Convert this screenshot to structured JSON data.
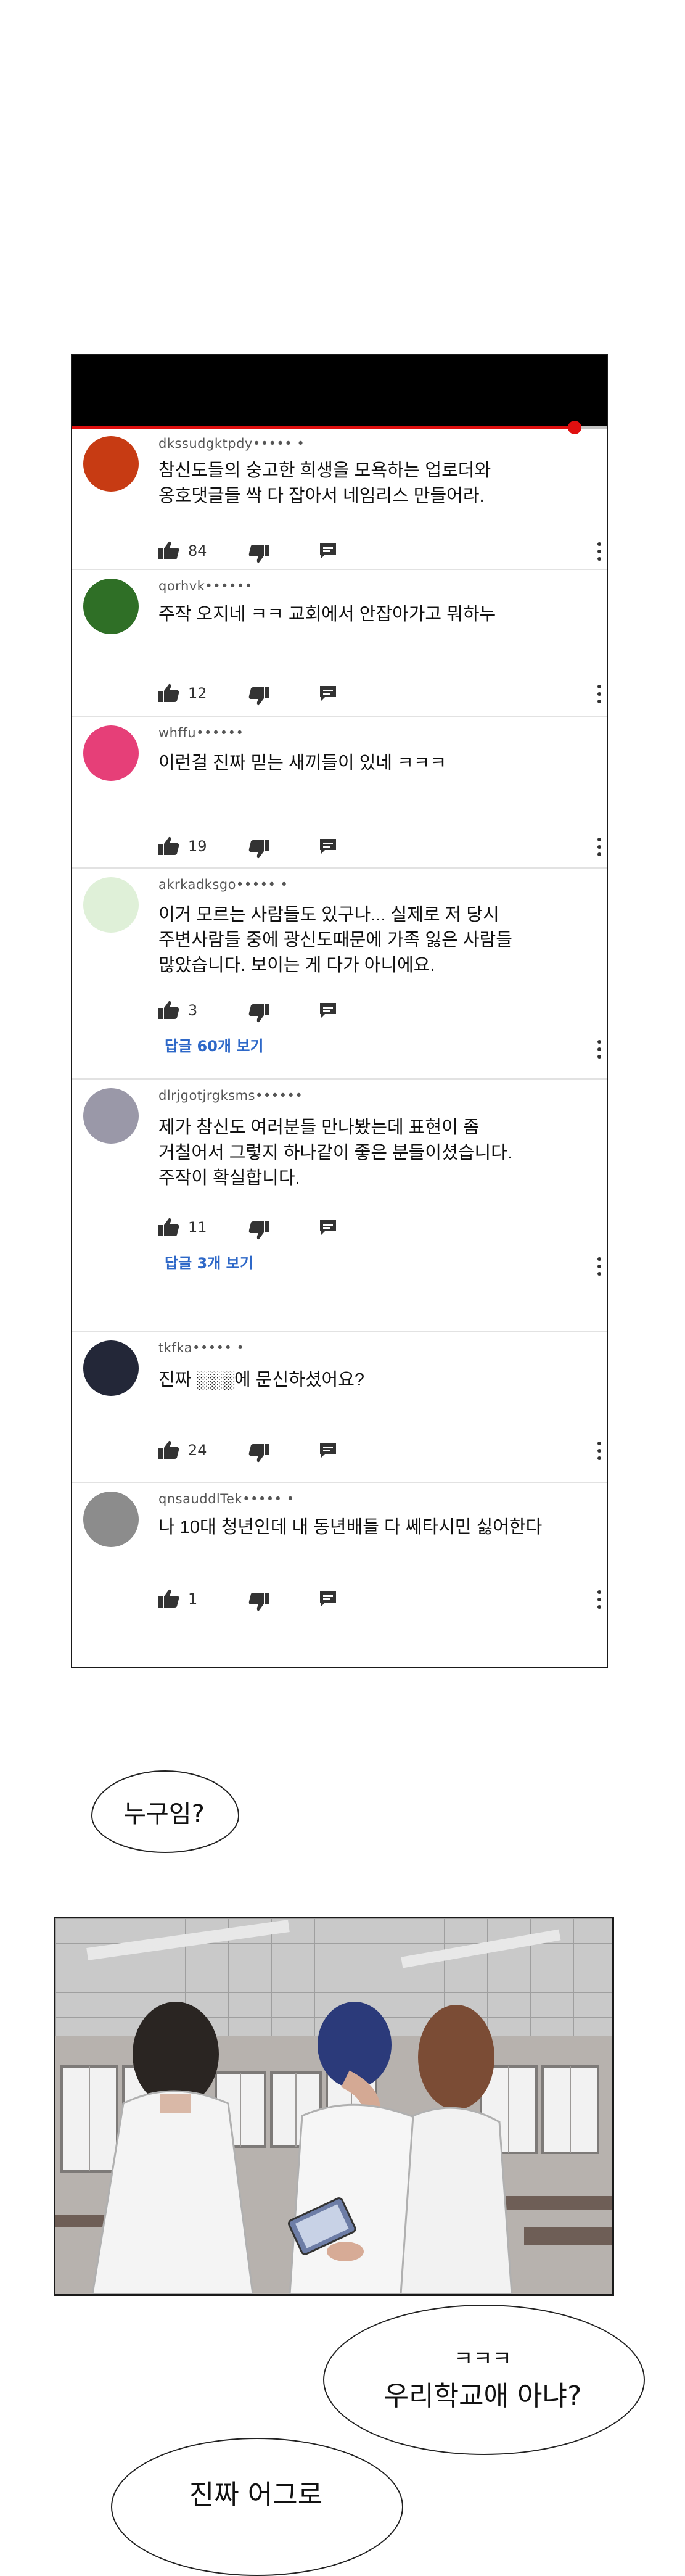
{
  "phone": {
    "progress_fraction": 0.94,
    "comments": [
      {
        "user": "dkssudgktpdy••••• •",
        "avatar_color": "#c73b13",
        "lines": [
          "참신도들의 숭고한 희생을 모욕하는 업로더와",
          "옹호댓글들 싹 다 잡아서 네임리스 만들어라."
        ],
        "likes": "84"
      },
      {
        "user": "qorhvk••••••",
        "avatar_color": "#2f6f26",
        "lines": [
          "주작 오지네 ㅋㅋ 교회에서 안잡아가고 뭐하누"
        ],
        "likes": "12"
      },
      {
        "user": "whffu••••••",
        "avatar_color": "#e63f78",
        "lines": [
          "이런걸 진짜 믿는 새끼들이 있네 ㅋㅋㅋ"
        ],
        "likes": "19"
      },
      {
        "user": "akrkadksgo••••• •",
        "avatar_color": "#dff0d8",
        "lines": [
          "이거 모르는 사람들도 있구나... 실제로 저 당시",
          "주변사람들 중에 광신도때문에 가족 잃은 사람들",
          "많았습니다. 보이는 게 다가 아니에요."
        ],
        "likes": "3",
        "replies": "답글 60개 보기"
      },
      {
        "user": "dlrjgotjrgksms••••••",
        "avatar_color": "#9a98a8",
        "lines": [
          "제가 참신도 여러분들 만나봤는데 표현이 좀",
          "거칠어서 그렇지 하나같이 좋은 분들이셨습니다.",
          "주작이 확실합니다."
        ],
        "likes": "11",
        "replies": "답글 3개 보기"
      },
      {
        "user": "tkfka•••••   •",
        "avatar_color": "#232738",
        "lines": [
          "진짜 ░░░에 문신하셨어요?"
        ],
        "likes": "24"
      },
      {
        "user": "qnsauddlTek••••• •",
        "avatar_color": "#8c8c8c",
        "lines": [
          "나 10대 청년인데 내 동년배들 다 쎄타시민 싫어한다"
        ],
        "likes": "1"
      }
    ]
  },
  "bubbles": {
    "who": "누구임?",
    "school_line1": "ㅋㅋㅋ",
    "school_line2": "우리학교애 아냐?",
    "bottom": "진짜 어그로"
  },
  "colors": {
    "progress": "#e01010",
    "reply_link": "#2e68c8",
    "icon": "#333333"
  }
}
